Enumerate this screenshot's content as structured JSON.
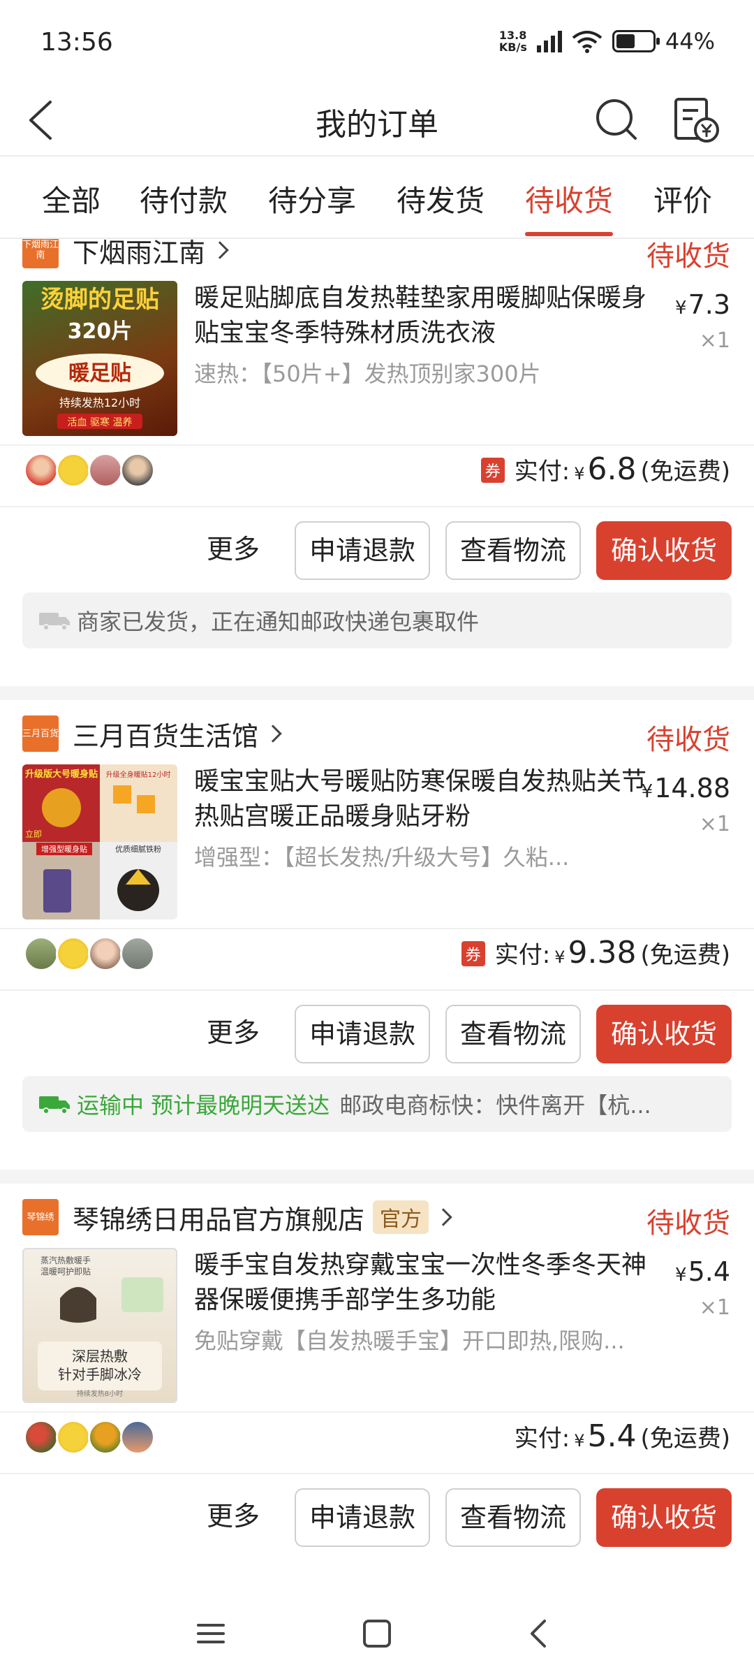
{
  "status_bar": {
    "time": "13:56",
    "net_speed_value": "13.8",
    "net_speed_unit": "KB/s",
    "battery": "44%"
  },
  "header": {
    "title": "我的订单"
  },
  "tabs": [
    {
      "label": "全部",
      "active": false
    },
    {
      "label": "待付款",
      "active": false
    },
    {
      "label": "待分享",
      "active": false
    },
    {
      "label": "待发货",
      "active": false
    },
    {
      "label": "待收货",
      "active": true
    },
    {
      "label": "评价",
      "active": false
    }
  ],
  "orders": [
    {
      "shop_logo_text": "下烟雨江南",
      "shop_name": "下烟雨江南",
      "status": "待收货",
      "product_title": "暖足贴脚底自发热鞋垫家用暖脚贴保暖身贴宝宝冬季特殊材质洗衣液",
      "product_spec": "速热：【50片+】发热顶别家300片",
      "thumb_text": {
        "line1": "烫脚的足贴",
        "line2": "320片",
        "line3": "暖足贴",
        "line4": "持续发热12小时",
        "line5": "活血 驱寒 温养"
      },
      "price_yen": "¥",
      "price": "7.3",
      "qty": "×1",
      "coupon": "券",
      "paid_label": "实付:",
      "paid_yen": "¥",
      "paid_amount": "6.8",
      "ship_note": "(免运费)",
      "more_label": "更多",
      "refund_label": "申请退款",
      "track_label": "查看物流",
      "confirm_label": "确认收货",
      "logistics_highlight": "",
      "logistics_text": "商家已发货，正在通知邮政快递包裹取件"
    },
    {
      "shop_logo_text": "三月百货",
      "shop_name": "三月百货生活馆",
      "status": "待收货",
      "product_title": "暖宝宝贴大号暖贴防寒保暖自发热贴关节热贴宫暖正品暖身贴牙粉",
      "product_spec": "增强型：【超长发热/升级大号】久粘...",
      "thumb_text": {
        "line1": "升级版大号暖身贴",
        "line2": "升级全身暖贴12小时",
        "line3": "立即",
        "line4": "增强型暖身贴",
        "line5": "优质细腻铁粉"
      },
      "price_yen": "¥",
      "price": "14.88",
      "qty": "×1",
      "coupon": "券",
      "paid_label": "实付:",
      "paid_yen": "¥",
      "paid_amount": "9.38",
      "ship_note": "(免运费)",
      "more_label": "更多",
      "refund_label": "申请退款",
      "track_label": "查看物流",
      "confirm_label": "确认收货",
      "logistics_highlight": "运输中 预计最晚明天送达",
      "logistics_text": "邮政电商标快：快件离开【杭..."
    },
    {
      "shop_logo_text": "琴锦绣",
      "shop_name": "琴锦绣日用品官方旗舰店",
      "official_tag": "官方",
      "status": "待收货",
      "product_title": "暖手宝自发热穿戴宝宝一次性冬季冬天神器保暖便携手部学生多功能",
      "product_spec": "免贴穿戴【自发热暖手宝】开口即热,限购...",
      "thumb_text": {
        "line1": "蒸汽热敷暖手",
        "line2": "温暖呵护即贴",
        "line3": "深层热敷",
        "line4": "针对手脚冰冷",
        "line5": "持续发热8小时"
      },
      "price_yen": "¥",
      "price": "5.4",
      "qty": "×1",
      "coupon": "",
      "paid_label": "实付:",
      "paid_yen": "¥",
      "paid_amount": "5.4",
      "ship_note": "(免运费)",
      "more_label": "更多",
      "refund_label": "申请退款",
      "track_label": "查看物流",
      "confirm_label": "确认收货",
      "logistics_highlight": "",
      "logistics_text": ""
    }
  ],
  "colors": {
    "accent": "#d9412f",
    "success": "#3aa83a",
    "muted": "#9a9a9a"
  },
  "icons": [
    "back-arrow-icon",
    "search-icon",
    "bill-icon",
    "chevron-right-icon",
    "truck-icon",
    "menu-icon",
    "home-icon",
    "back-icon"
  ]
}
